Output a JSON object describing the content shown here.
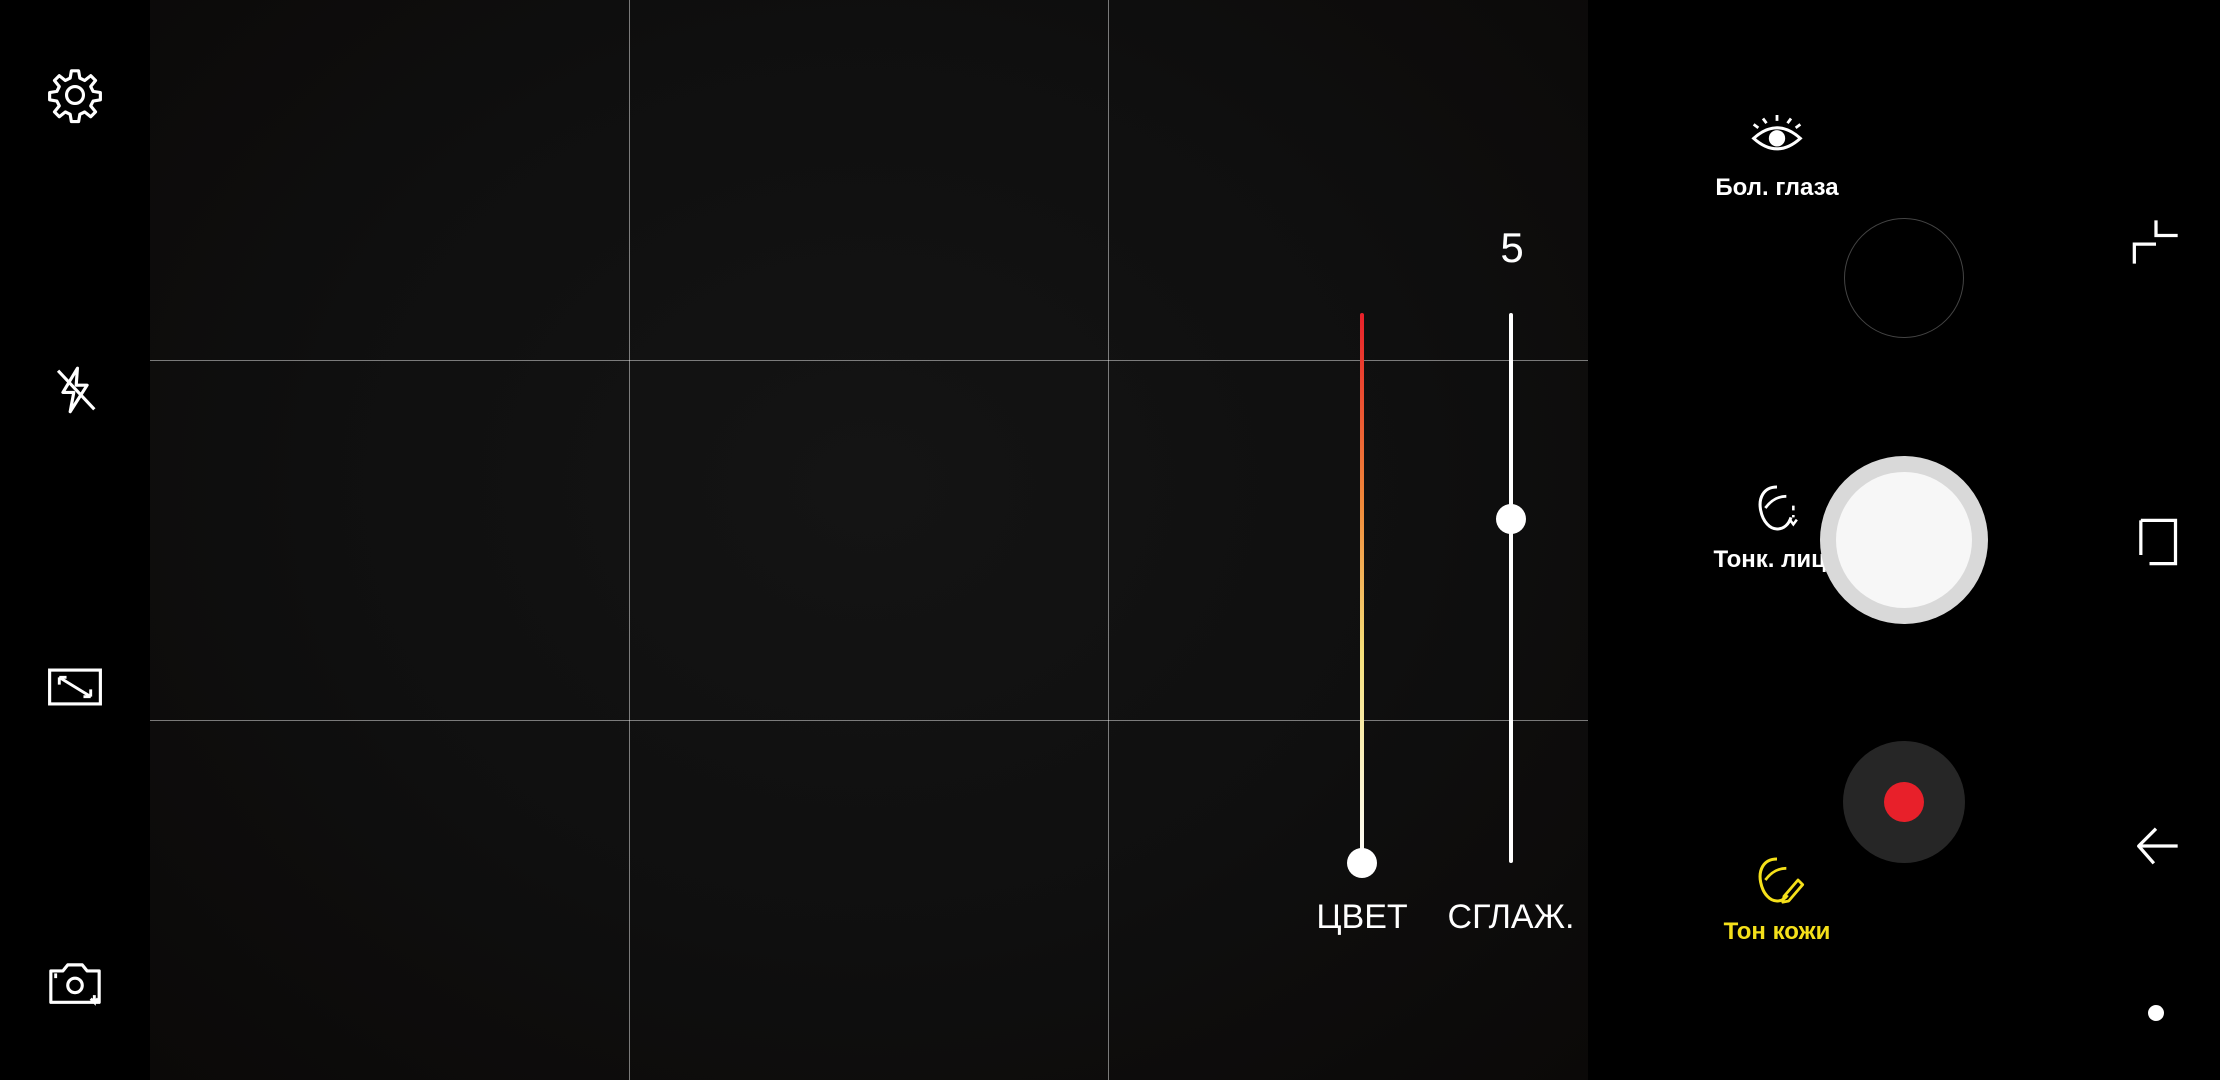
{
  "beauty": {
    "sliders": {
      "color": {
        "label": "ЦВЕТ",
        "value_fraction": 0.0
      },
      "smooth": {
        "label": "СГЛАЖ.",
        "value": "5",
        "value_fraction": 0.625
      }
    },
    "effects": [
      {
        "label": "Бол. глаза",
        "icon": "large-eyes-icon",
        "active": false
      },
      {
        "label": "Тонк. лицо",
        "icon": "slim-face-icon",
        "active": false
      },
      {
        "label": "Тон кожи",
        "icon": "skin-tone-icon",
        "active": true
      }
    ]
  },
  "left_toolbar": {
    "icons": [
      "gear-icon",
      "flash-off-icon",
      "aspect-ratio-icon",
      "switch-camera-icon"
    ]
  },
  "colors": {
    "active_label": "#f5e01a",
    "record_dot": "#e8202a",
    "color_track_top": "#e8202a",
    "color_track_mid": "#f5e07a"
  },
  "navigation": {
    "icons": [
      "recent-apps-icon",
      "home-icon",
      "back-icon"
    ]
  }
}
